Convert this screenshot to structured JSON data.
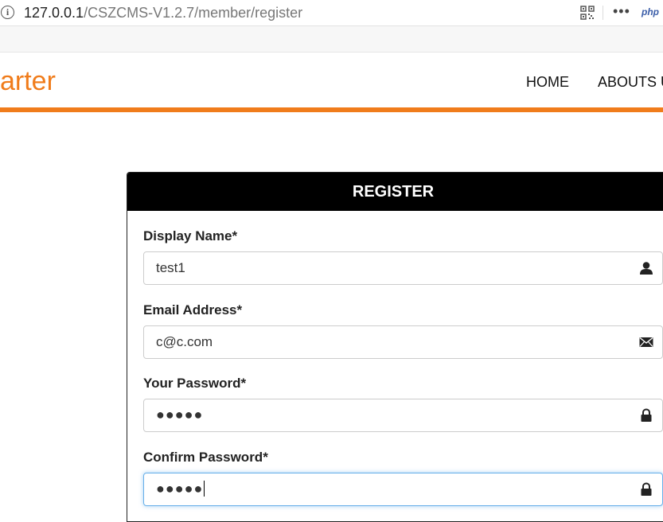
{
  "browser": {
    "url_host": "127.0.0.1",
    "url_path": "/CSZCMS-V1.2.7/member/register",
    "more_label": "•••",
    "php_label": "php"
  },
  "site": {
    "brand": "arter",
    "nav": [
      "HOME",
      "ABOUTS U"
    ],
    "accent_color": "#f07c1b"
  },
  "form": {
    "title": "REGISTER",
    "fields": [
      {
        "label": "Display Name*",
        "value": "test1",
        "icon": "user-icon"
      },
      {
        "label": "Email Address*",
        "value": "c@c.com",
        "icon": "envelope-icon"
      },
      {
        "label": "Your Password*",
        "value": "●●●●●",
        "icon": "lock-icon"
      },
      {
        "label": "Confirm Password*",
        "value": "●●●●●",
        "icon": "lock-icon",
        "focused": true
      }
    ]
  }
}
